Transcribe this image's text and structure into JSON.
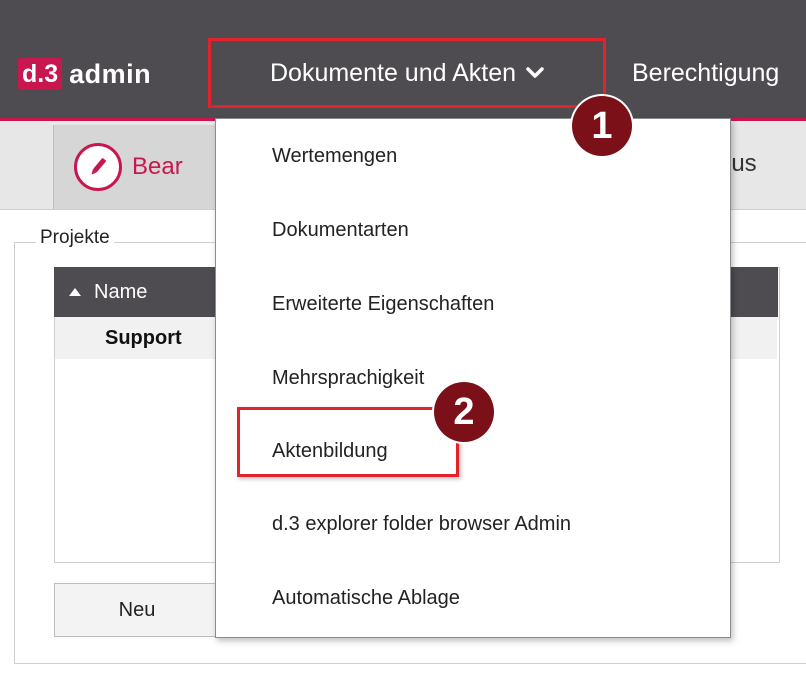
{
  "app": {
    "logo_badge": "d.3",
    "logo_text": "admin"
  },
  "nav": {
    "docs_label": "Dokumente und Akten",
    "berechtigung_label": "Berechtigung"
  },
  "toolbar": {
    "edit_label": "Bear",
    "right_partial": "lus"
  },
  "panel": {
    "legend": "Projekte",
    "grid_header": "Name",
    "rows": [
      "Support"
    ],
    "new_button": "Neu"
  },
  "dropdown": {
    "items": [
      "Wertemengen",
      "Dokumentarten",
      "Erweiterte Eigenschaften",
      "Mehrsprachigkeit",
      "Aktenbildung",
      "d.3 explorer folder browser Admin",
      "Automatische Ablage"
    ]
  },
  "markers": [
    "1",
    "2"
  ],
  "colors": {
    "accent": "#c8174e",
    "topbar": "#4e4c50",
    "highlight": "#e3232c",
    "marker": "#7b1018"
  },
  "icons": {
    "chevron": "chevron-down-icon",
    "pencil": "pencil-icon",
    "sort": "sort-ascending-icon"
  }
}
